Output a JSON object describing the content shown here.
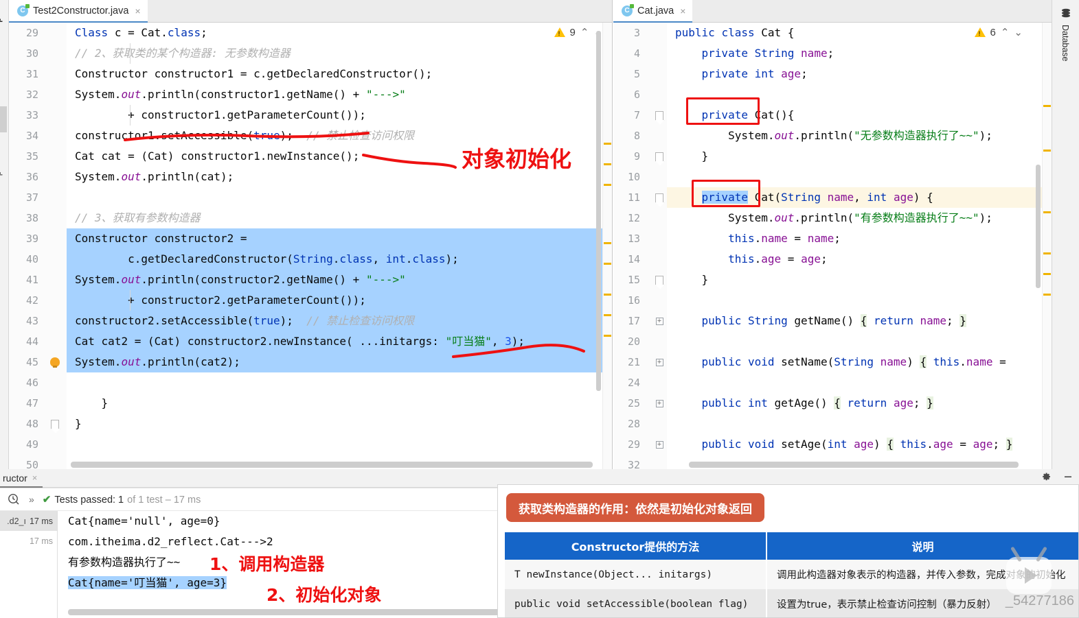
{
  "left_strip": {
    "labels": [
      "p",
      "p"
    ]
  },
  "right_strip": {
    "label": "Database",
    "icon": "database-icon"
  },
  "editor": {
    "left_pane": {
      "tab": {
        "label": "Test2Constructor.java",
        "icon": "java-class-icon",
        "close": "×"
      },
      "warning": {
        "count": "9",
        "up": "⌃",
        "down": "⌄"
      },
      "line_numbers": [
        "29",
        "30",
        "31",
        "32",
        "33",
        "34",
        "35",
        "36",
        "37",
        "38",
        "39",
        "40",
        "41",
        "42",
        "43",
        "44",
        "45",
        "46",
        "47",
        "48",
        "49",
        "50"
      ],
      "lines": [
        "Class c = Cat.class;",
        "// 2、获取类的某个构造器: 无参数构造器",
        "Constructor constructor1 = c.getDeclaredConstructor();",
        "System.out.println(constructor1.getName() + \"--->\"",
        "        + constructor1.getParameterCount());",
        "constructor1.setAccessible(true);  // 禁止检查访问权限",
        "Cat cat = (Cat) constructor1.newInstance();",
        "System.out.println(cat);",
        "",
        "// 3、获取有参数构造器",
        "Constructor constructor2 =",
        "        c.getDeclaredConstructor(String.class, int.class);",
        "System.out.println(constructor2.getName() + \"--->\"",
        "        + constructor2.getParameterCount());",
        "constructor2.setAccessible(true);  // 禁止检查访问权限",
        "Cat cat2 = (Cat) constructor2.newInstance( ...initargs: \"叮当猫\", 3);",
        "System.out.println(cat2);",
        "",
        "    }",
        "}",
        "",
        ""
      ],
      "inlay_hint": "...initargs:"
    },
    "right_pane": {
      "tab": {
        "label": "Cat.java",
        "icon": "java-class-icon",
        "close": "×"
      },
      "warning": {
        "count": "6",
        "up": "⌃",
        "down": "⌄"
      },
      "line_numbers": [
        "3",
        "4",
        "5",
        "6",
        "7",
        "8",
        "9",
        "10",
        "11",
        "12",
        "13",
        "14",
        "15",
        "16",
        "17",
        "20",
        "21",
        "24",
        "25",
        "28",
        "29",
        "32"
      ],
      "lines": [
        "public class Cat {",
        "    private String name;",
        "    private int age;",
        "",
        "    private Cat(){",
        "        System.out.println(\"无参数构造器执行了~~\");",
        "    }",
        "",
        "    private Cat(String name, int age) {",
        "        System.out.println(\"有参数构造器执行了~~\");",
        "        this.name = name;",
        "        this.age = age;",
        "    }",
        "",
        "    public String getName() { return name; }",
        "",
        "    public void setName(String name) { this.name = ",
        "",
        "    public int getAge() { return age; }",
        "",
        "    public void setAge(int age) { this.age = age; }",
        ""
      ]
    }
  },
  "bottom_panel": {
    "tab": {
      "label": "ructor",
      "close": "×"
    },
    "actions": {
      "settings": "gear-icon",
      "minimize": "minimize-icon"
    },
    "run_toolbar": {
      "history_icon": "run-history-icon",
      "expand": "»",
      "check": "✔",
      "status_main": "Tests passed: 1",
      "status_dim": "of 1 test – 17 ms"
    },
    "test_tree": [
      {
        "name": ".d2_ı",
        "time": "17 ms",
        "selected": true
      },
      {
        "name": "",
        "time": "17 ms",
        "selected": false
      }
    ],
    "console": [
      "Cat{name='null', age=0}",
      "com.itheima.d2_reflect.Cat--->2",
      "有参数构造器执行了~~",
      "Cat{name='叮当猫', age=3}"
    ]
  },
  "annotations": {
    "object_init": "对象初始化",
    "step1": "1、调用构造器",
    "step2": "2、初始化对象",
    "color": "#ee1111"
  },
  "slide": {
    "badge": "获取类构造器的作用：依然是初始化对象返回",
    "badge_color": "#d4593c",
    "header_color": "#1565c8",
    "table": {
      "headers": [
        "Constructor提供的方法",
        "说明"
      ],
      "rows": [
        [
          "T newInstance(Object... initargs)",
          "调用此构造器对象表示的构造器，并传入参数，完成对象的初始化"
        ],
        [
          "public void  setAccessible(boolean flag)",
          "设置为true，表示禁止检查访问控制（暴力反射）"
        ]
      ]
    },
    "watermark": "_54277186",
    "play_logo": "video-play-icon"
  }
}
